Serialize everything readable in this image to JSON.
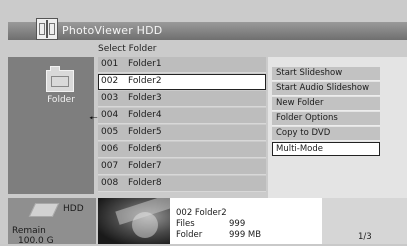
{
  "app": {
    "title": "PhotoViewer  HDD"
  },
  "header": {
    "select_label": "Select Folder"
  },
  "left_panel": {
    "label": "Folder",
    "icon": "folder-icon"
  },
  "list": {
    "items": [
      {
        "num": "001",
        "name": "Folder1"
      },
      {
        "num": "002",
        "name": "Folder2"
      },
      {
        "num": "003",
        "name": "Folder3"
      },
      {
        "num": "004",
        "name": "Folder4"
      },
      {
        "num": "005",
        "name": "Folder5"
      },
      {
        "num": "006",
        "name": "Folder6"
      },
      {
        "num": "007",
        "name": "Folder7"
      },
      {
        "num": "008",
        "name": "Folder8"
      }
    ],
    "selected_index": 1
  },
  "menu": {
    "items": [
      "Start Slideshow",
      "Start Audio Slideshow",
      "New Folder",
      "Folder Options",
      "Copy to DVD",
      "Multi-Mode"
    ],
    "focused_index": 5
  },
  "storage": {
    "device": "HDD",
    "remain_label": "Remain",
    "remain_value": "100.0 G"
  },
  "info": {
    "title": "002  Folder2",
    "files_label": "Files",
    "files_value": "999",
    "folder_label": "Folder",
    "folder_value": "999 MB"
  },
  "pager": {
    "text": "1/3"
  }
}
